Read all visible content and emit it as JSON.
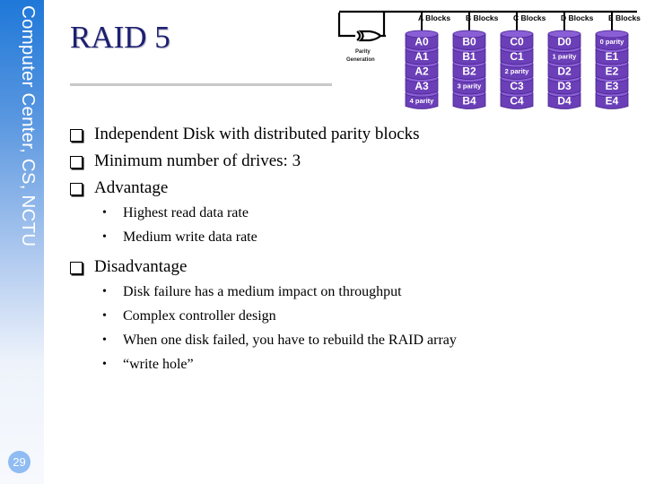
{
  "sidebar": {
    "label": "Computer Center, CS, NCTU",
    "page_number": "29"
  },
  "slide": {
    "title": "RAID 5",
    "bullets": [
      {
        "text": "Independent Disk with distributed parity blocks",
        "sub": []
      },
      {
        "text": "Minimum number of drives: 3",
        "sub": []
      },
      {
        "text": "Advantage",
        "sub": [
          "Highest read data rate",
          "Medium write data rate"
        ]
      },
      {
        "text": "Disadvantage",
        "sub": [
          "Disk failure has a medium impact on throughput",
          "Complex controller design",
          "When one disk failed, you have to rebuild the RAID array",
          "“write hole”"
        ]
      }
    ]
  },
  "diagram": {
    "parity_label_1": "Parity",
    "parity_label_2": "Generation",
    "disks": [
      {
        "label": "A Blocks",
        "blocks": [
          "A0",
          "A1",
          "A2",
          "A3",
          "4 parity"
        ]
      },
      {
        "label": "B Blocks",
        "blocks": [
          "B0",
          "B1",
          "B2",
          "3 parity",
          "B4"
        ]
      },
      {
        "label": "C Blocks",
        "blocks": [
          "C0",
          "C1",
          "2 parity",
          "C3",
          "C4"
        ]
      },
      {
        "label": "D Blocks",
        "blocks": [
          "D0",
          "1 parity",
          "D2",
          "D3",
          "D4"
        ]
      },
      {
        "label": "E Blocks",
        "blocks": [
          "0 parity",
          "E1",
          "E2",
          "E3",
          "E4"
        ]
      }
    ],
    "colors": {
      "disk": "#6b3fb8",
      "disk_dark": "#4a2490",
      "disk_top": "#8a5fd6"
    }
  }
}
